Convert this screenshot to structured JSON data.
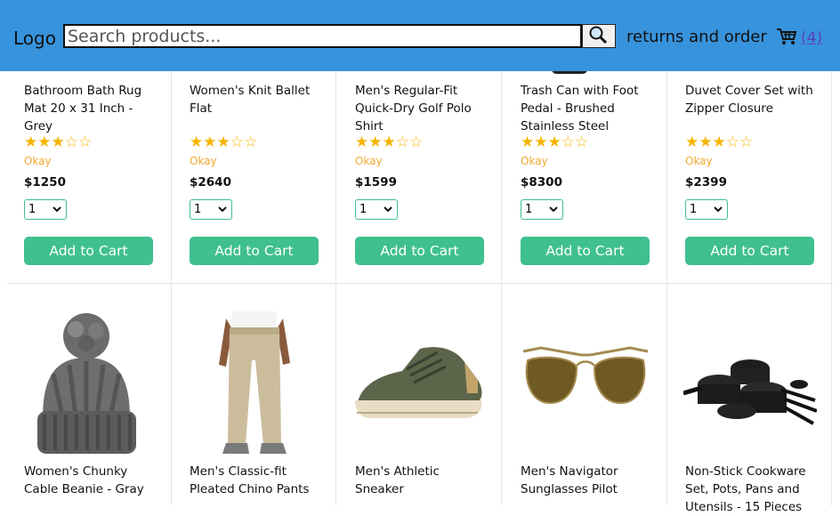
{
  "header": {
    "logo": "Logo",
    "search_placeholder": "Search products...",
    "returns": "returns and order",
    "cart_count": "(4)"
  },
  "row1": [
    {
      "name": "Bathroom Bath Rug Mat 20 x 31 Inch - Grey",
      "rating_text": "Okay",
      "stars": 3,
      "price": "$1250",
      "qty": "1",
      "button": "Add to Cart"
    },
    {
      "name": "Women's Knit Ballet Flat",
      "rating_text": "Okay",
      "stars": 3,
      "price": "$2640",
      "qty": "1",
      "button": "Add to Cart"
    },
    {
      "name": "Men's Regular-Fit Quick-Dry Golf Polo Shirt",
      "rating_text": "Okay",
      "stars": 3,
      "price": "$1599",
      "qty": "1",
      "button": "Add to Cart"
    },
    {
      "name": "Trash Can with Foot Pedal - Brushed Stainless Steel",
      "rating_text": "Okay",
      "stars": 3,
      "price": "$8300",
      "qty": "1",
      "button": "Add to Cart"
    },
    {
      "name": "Duvet Cover Set with Zipper Closure",
      "rating_text": "Okay",
      "stars": 3,
      "price": "$2399",
      "qty": "1",
      "button": "Add to Cart"
    }
  ],
  "row2": [
    {
      "name": "Women's Chunky Cable Beanie - Gray",
      "image": "beanie"
    },
    {
      "name": "Men's Classic-fit Pleated Chino Pants",
      "image": "chino-pants"
    },
    {
      "name": "Men's Athletic Sneaker",
      "image": "sneaker"
    },
    {
      "name": "Men's Navigator Sunglasses Pilot",
      "image": "sunglasses"
    },
    {
      "name": "Non-Stick Cookware Set, Pots, Pans and Utensils - 15 Pieces",
      "image": "cookware"
    }
  ],
  "colors": {
    "header": "#3793dc",
    "button": "#3fc08e",
    "star": "#f5b400"
  }
}
